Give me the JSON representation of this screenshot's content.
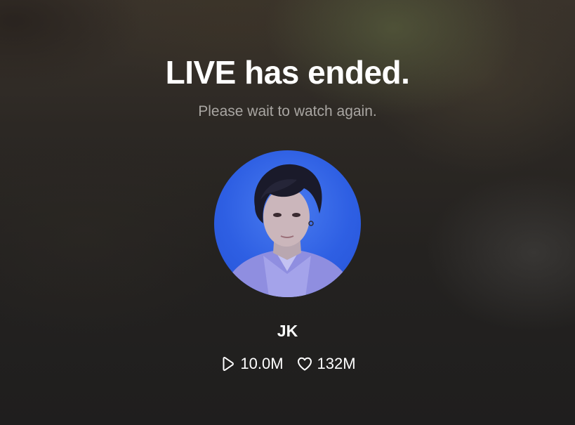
{
  "screen": {
    "title": "LIVE has ended.",
    "subtitle": "Please wait to watch again."
  },
  "profile": {
    "name": "JK",
    "avatar_icon": "profile-photo",
    "avatar_bg_color": "#2e5fe3"
  },
  "stats": {
    "plays": {
      "icon": "play-icon",
      "value": "10.0M"
    },
    "likes": {
      "icon": "heart-icon",
      "value": "132M"
    }
  },
  "colors": {
    "title": "#ffffff",
    "subtitle": "#a9a6a2",
    "background": "#2a2622"
  }
}
